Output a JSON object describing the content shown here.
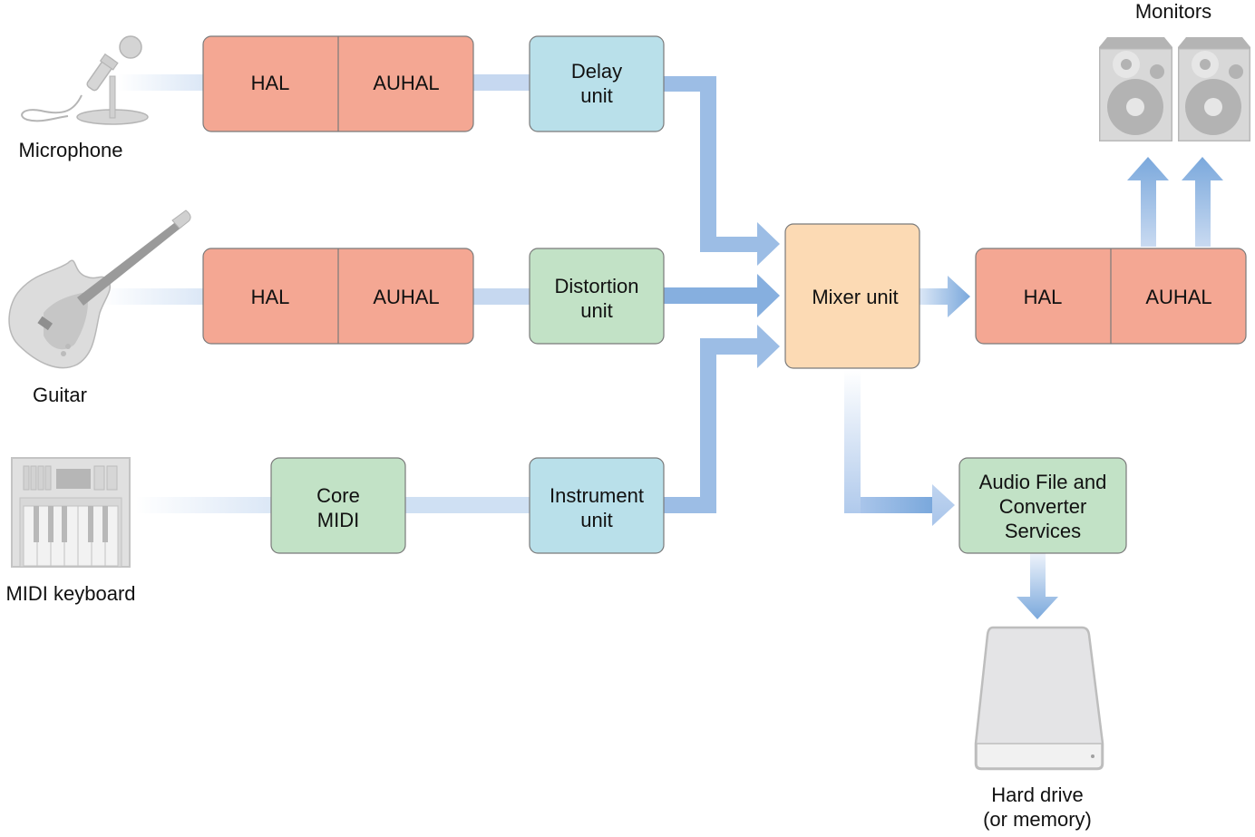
{
  "colors": {
    "hal_fill": "#f4a793",
    "delay_fill": "#b9e0ea",
    "green_fill": "#c2e2c6",
    "mixer_fill": "#fcdab4",
    "arrow": "#7aa8dc",
    "border": "#7a7a7a",
    "device_gray": "#c9c9c9"
  },
  "devices": {
    "microphone": "Microphone",
    "guitar": "Guitar",
    "midi_keyboard": "MIDI keyboard",
    "monitors": "Monitors",
    "hard_drive_line1": "Hard drive",
    "hard_drive_line2": "(or memory)"
  },
  "row1": {
    "hal": "HAL",
    "auhal": "AUHAL",
    "unit_line1": "Delay",
    "unit_line2": "unit"
  },
  "row2": {
    "hal": "HAL",
    "auhal": "AUHAL",
    "unit_line1": "Distortion",
    "unit_line2": "unit"
  },
  "row3": {
    "midi_line1": "Core",
    "midi_line2": "MIDI",
    "unit_line1": "Instrument",
    "unit_line2": "unit"
  },
  "mixer": {
    "label": "Mixer unit"
  },
  "output": {
    "hal": "HAL",
    "auhal": "AUHAL"
  },
  "file_services": {
    "line1": "Audio File and",
    "line2": "Converter",
    "line3": "Services"
  }
}
